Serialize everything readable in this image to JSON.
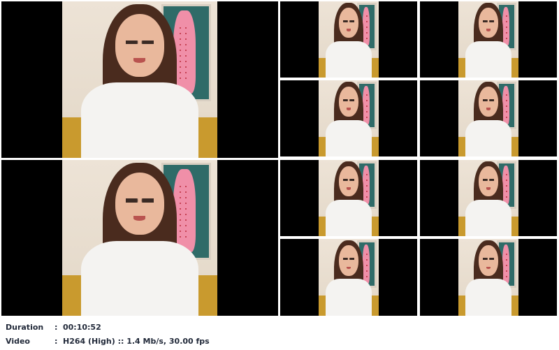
{
  "thumbnails": [
    {
      "id": "large-1"
    },
    {
      "id": "large-2"
    },
    {
      "id": "small-1"
    },
    {
      "id": "small-2"
    },
    {
      "id": "small-3"
    },
    {
      "id": "small-4"
    },
    {
      "id": "small-5"
    },
    {
      "id": "small-6"
    },
    {
      "id": "small-7"
    },
    {
      "id": "small-8"
    }
  ],
  "info": {
    "duration_label": "Duration",
    "duration_sep": ":",
    "duration_value": "00:10:52",
    "video_label": "Video",
    "video_sep": ":",
    "video_value": "H264 (High) :: 1.4 Mb/s, 30.00 fps"
  }
}
